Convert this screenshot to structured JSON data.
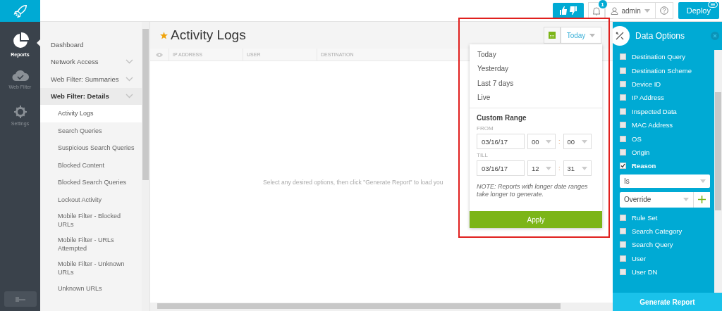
{
  "topbar": {
    "notifications_badge": "1",
    "user": "admin",
    "deploy_button": "Deploy"
  },
  "rail": [
    {
      "label": "Reports",
      "selected": true
    },
    {
      "label": "Web Filter",
      "selected": false
    },
    {
      "label": "Settings",
      "selected": false
    }
  ],
  "nav": [
    {
      "label": "Dashboard",
      "expandable": false,
      "expanded": false,
      "selected": false
    },
    {
      "label": "Network Access",
      "expandable": true,
      "expanded": false,
      "selected": false
    },
    {
      "label": "Web Filter: Summaries",
      "expandable": true,
      "expanded": false,
      "selected": false
    },
    {
      "label": "Web Filter: Details",
      "expandable": true,
      "expanded": true,
      "selected": false,
      "children": [
        {
          "label": "Activity Logs",
          "selected": true
        },
        {
          "label": "Search Queries",
          "selected": false
        },
        {
          "label": "Suspicious Search Queries",
          "selected": false
        },
        {
          "label": "Blocked Content",
          "selected": false
        },
        {
          "label": "Blocked Search Queries",
          "selected": false
        },
        {
          "label": "Lockout Activity",
          "selected": false
        },
        {
          "label": "Mobile Filter - Blocked URLs",
          "selected": false
        },
        {
          "label": "Mobile Filter - URLs Attempted",
          "selected": false
        },
        {
          "label": "Mobile Filter - Unknown URLs",
          "selected": false
        },
        {
          "label": "Unknown URLs",
          "selected": false
        }
      ]
    }
  ],
  "page": {
    "title": "Activity Logs",
    "favorite": true,
    "range_button": "Today",
    "table": {
      "columns": [
        "IP ADDRESS",
        "USER",
        "DESTINATION"
      ]
    },
    "empty_message": "Select any desired options, then click \"Generate Report\" to load you"
  },
  "range_menu": {
    "options": [
      "Today",
      "Yesterday",
      "Last 7 days",
      "Live"
    ],
    "custom_heading": "Custom Range",
    "from": {
      "label": "FROM",
      "date": "03/16/17",
      "hour": "00",
      "separator": ":",
      "minute": "00"
    },
    "till": {
      "label": "TILL",
      "date": "03/16/17",
      "hour": "12",
      "separator": ":",
      "minute": "31"
    },
    "note": "NOTE: Reports with longer date ranges take longer to generate.",
    "apply_button": "Apply"
  },
  "data_options": {
    "title": "Data Options",
    "items": [
      {
        "label": "Destination Query",
        "checked": false
      },
      {
        "label": "Destination Scheme",
        "checked": false
      },
      {
        "label": "Device ID",
        "checked": false
      },
      {
        "label": "IP Address",
        "checked": false
      },
      {
        "label": "Inspected Data",
        "checked": false
      },
      {
        "label": "MAC Address",
        "checked": false
      },
      {
        "label": "OS",
        "checked": false
      },
      {
        "label": "Origin",
        "checked": false
      },
      {
        "label": "Reason",
        "checked": true,
        "filter": {
          "operator": "Is",
          "value": "Override"
        }
      },
      {
        "label": "Rule Set",
        "checked": false
      },
      {
        "label": "Search Category",
        "checked": false
      },
      {
        "label": "Search Query",
        "checked": false
      },
      {
        "label": "User",
        "checked": false
      },
      {
        "label": "User DN",
        "checked": false
      }
    ],
    "generate_button": "Generate Report"
  }
}
